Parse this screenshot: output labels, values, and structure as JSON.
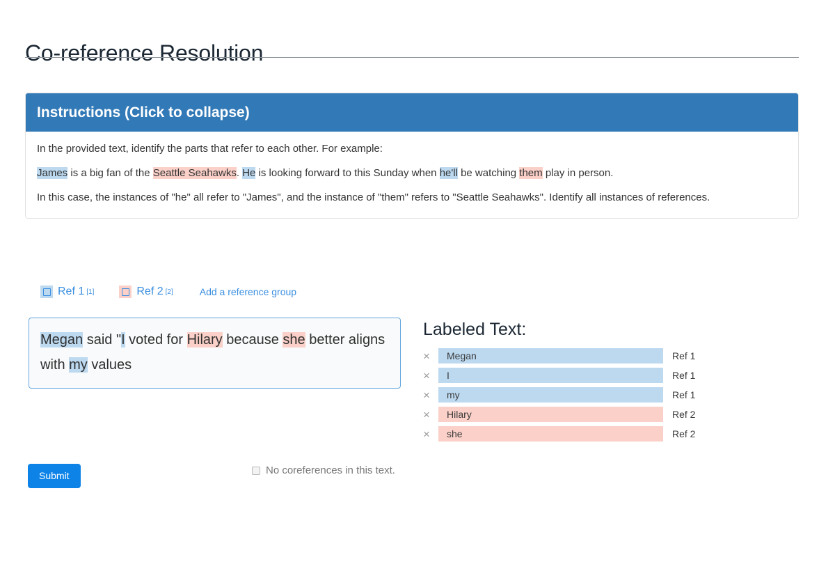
{
  "page_title": "Co-reference Resolution",
  "instructions": {
    "header_label": "Instructions (Click to collapse)",
    "intro": "In the provided text, identify the parts that refer to each other. For example:",
    "example_segments": [
      {
        "text": "James",
        "highlight": "blue"
      },
      {
        "text": " is a big fan of the ",
        "highlight": "none"
      },
      {
        "text": "Seattle Seahawks",
        "highlight": "pink"
      },
      {
        "text": ". ",
        "highlight": "none"
      },
      {
        "text": "He",
        "highlight": "blue"
      },
      {
        "text": " is looking forward to this Sunday when ",
        "highlight": "none"
      },
      {
        "text": "he'll",
        "highlight": "blue"
      },
      {
        "text": " be watching ",
        "highlight": "none"
      },
      {
        "text": "them",
        "highlight": "pink"
      },
      {
        "text": " play in person.",
        "highlight": "none"
      }
    ],
    "conclusion": "In this case, the instances of \"he\" all refer to \"James\", and the instance of \"them\" refers to \"Seattle Seahawks\". Identify all instances of references."
  },
  "ref_groups": [
    {
      "label": "Ref 1",
      "marker": "[1]",
      "color": "blue",
      "checked": false
    },
    {
      "label": "Ref 2",
      "marker": "[2]",
      "color": "pink",
      "checked": false
    }
  ],
  "add_reference_group_label": "Add a reference group",
  "annotation_text_segments": [
    {
      "text": "Megan",
      "highlight": "blue"
    },
    {
      "text": " said \"",
      "highlight": "none"
    },
    {
      "text": "I",
      "highlight": "blue"
    },
    {
      "text": " voted for ",
      "highlight": "none"
    },
    {
      "text": "Hilary",
      "highlight": "pink"
    },
    {
      "text": " because ",
      "highlight": "none"
    },
    {
      "text": "she",
      "highlight": "pink"
    },
    {
      "text": " better aligns with ",
      "highlight": "none"
    },
    {
      "text": "my",
      "highlight": "blue"
    },
    {
      "text": " values",
      "highlight": "none"
    }
  ],
  "labeled_text": {
    "title": "Labeled Text:",
    "remove_icon": "×",
    "rows": [
      {
        "text": "Megan",
        "ref": "Ref 1",
        "color": "blue"
      },
      {
        "text": "I",
        "ref": "Ref 1",
        "color": "blue"
      },
      {
        "text": "my",
        "ref": "Ref 1",
        "color": "blue"
      },
      {
        "text": "Hilary",
        "ref": "Ref 2",
        "color": "pink"
      },
      {
        "text": "she",
        "ref": "Ref 2",
        "color": "pink"
      }
    ]
  },
  "footer": {
    "submit_label": "Submit",
    "no_coreferences_label": "No coreferences in this text.",
    "no_coreferences_checked": false
  },
  "colors": {
    "ref1_highlight": "#bcd9f0",
    "ref2_highlight": "#fad0c8",
    "panel_header": "#3279b7",
    "submit_button": "#0d83e8",
    "link": "#3b8fe0"
  }
}
